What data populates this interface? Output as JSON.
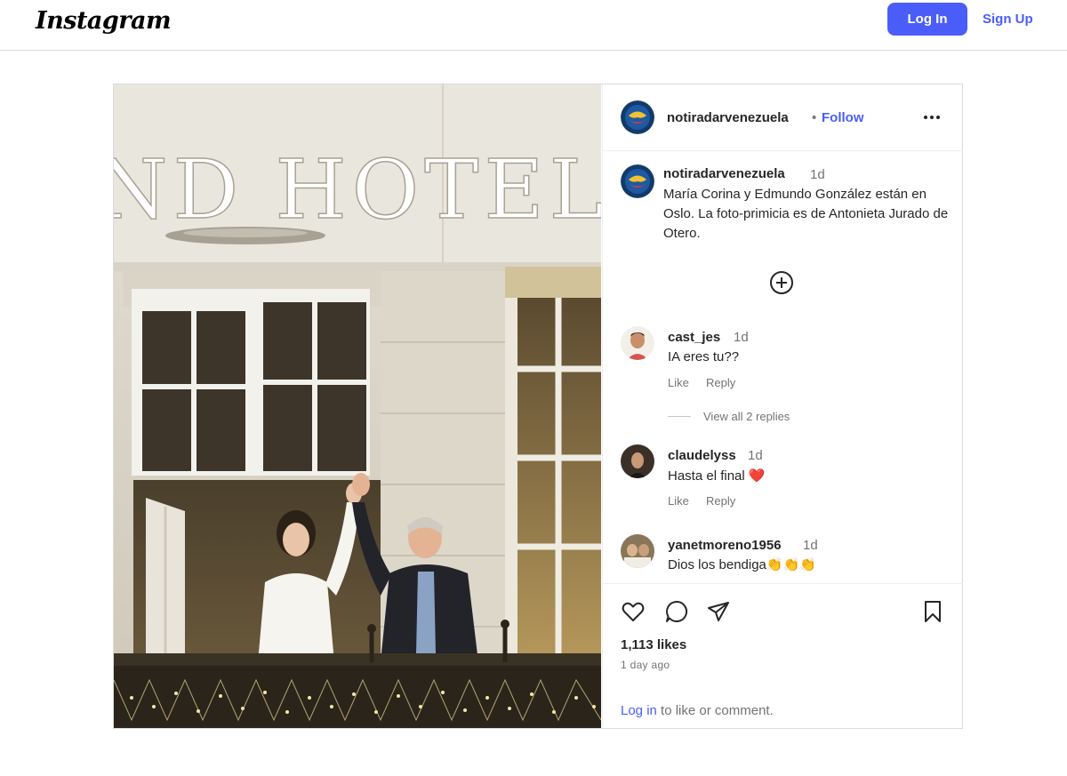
{
  "header": {
    "logo_text": "Instagram",
    "login_label": "Log In",
    "signup_label": "Sign Up"
  },
  "post": {
    "username": "notiradarvenezuela",
    "separator": "•",
    "follow_label": "Follow",
    "more_icon": "more-horizontal-icon",
    "photo_sign_text": "ND HOTEL",
    "caption": {
      "username": "notiradarvenezuela",
      "time": "1d",
      "text": "María Corina y Edmundo González están en Oslo. La foto-primicia es de Antonieta Jurado de Otero."
    },
    "load_more_icon": "plus-circle-icon",
    "comments": [
      {
        "username": "cast_jes",
        "time": "1d",
        "text": "IA eres tu??",
        "like_label": "Like",
        "reply_label": "Reply",
        "view_replies": "View all 2 replies"
      },
      {
        "username": "claudelyss",
        "time": "1d",
        "text": "Hasta el final ❤️",
        "like_label": "Like",
        "reply_label": "Reply"
      },
      {
        "username": "yanetmoreno1956",
        "time": "1d",
        "text": "Dios los bendiga👏👏👏"
      }
    ],
    "icons": [
      "heart-icon",
      "comment-icon",
      "share-icon",
      "bookmark-icon"
    ],
    "likes": "1,113 likes",
    "time_ago": "1 day ago",
    "login_prompt": {
      "link": "Log in",
      "rest": " to like or comment."
    }
  },
  "colors": {
    "accent": "#4a5df9",
    "text": "#262626",
    "muted": "#737373",
    "border": "#dbdbdb"
  }
}
